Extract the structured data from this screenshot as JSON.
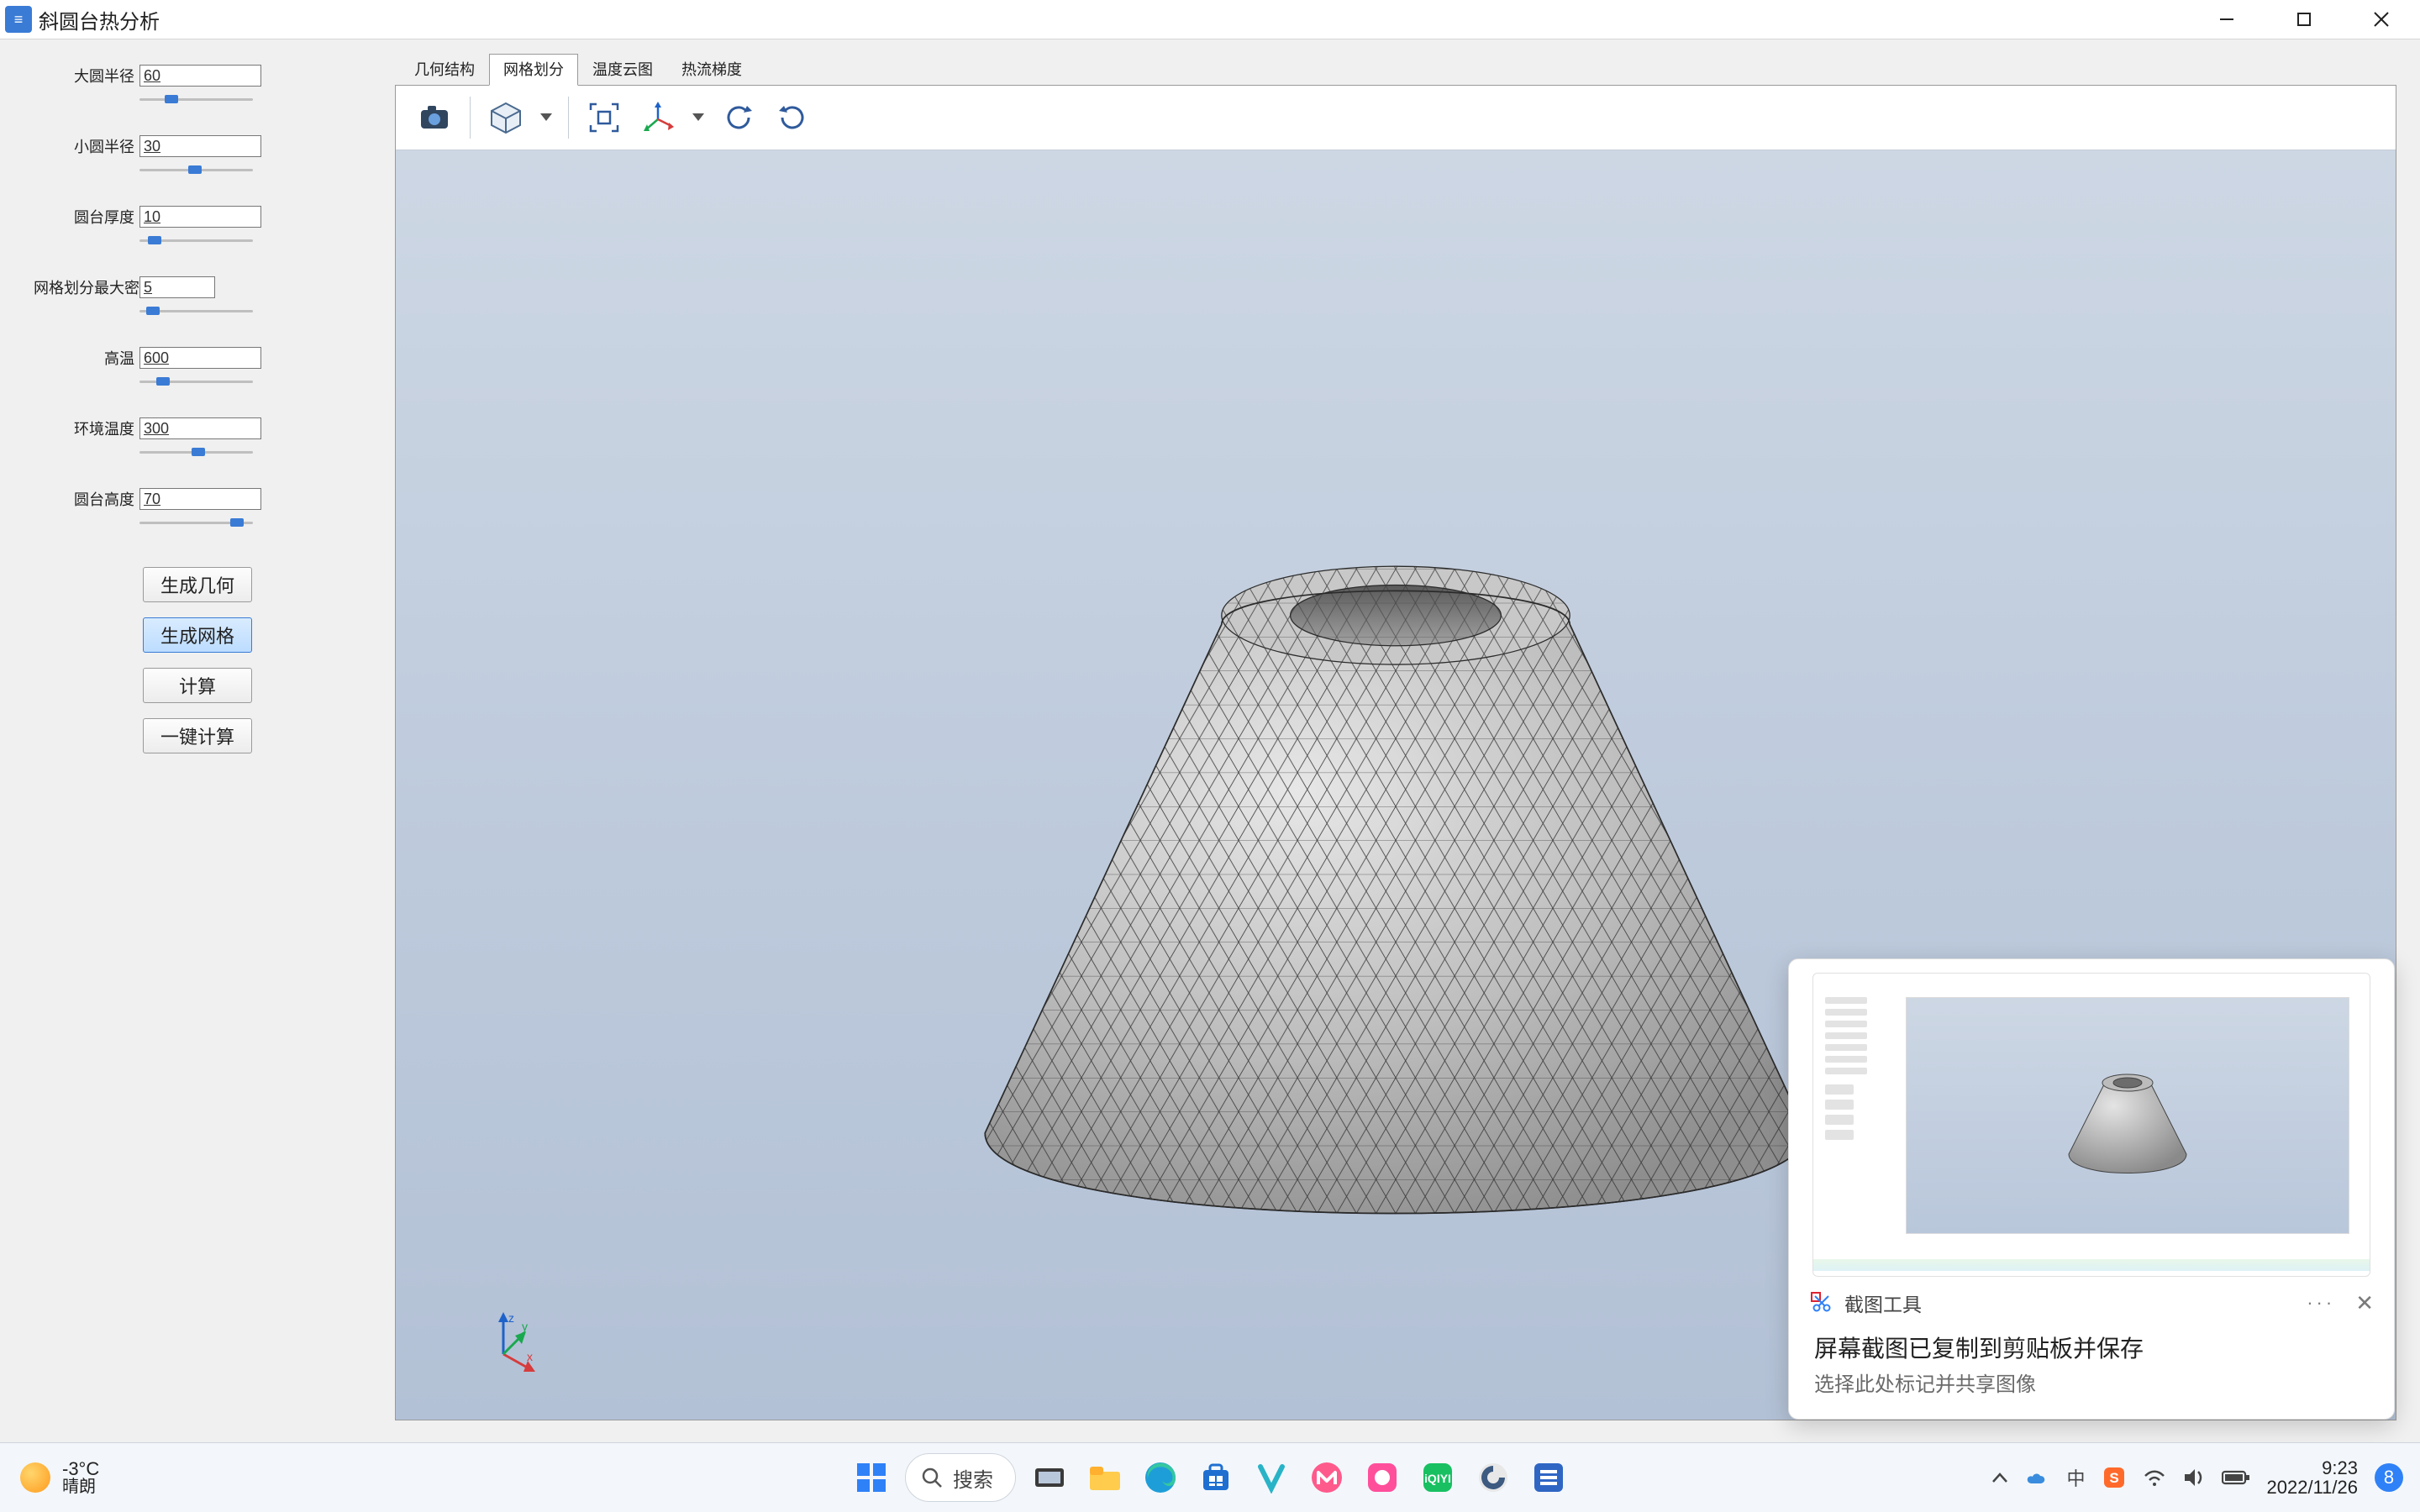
{
  "window": {
    "title": "斜圆台热分析"
  },
  "sidebar": {
    "params": [
      {
        "label": "大圆半径",
        "value": "60",
        "thumb": 30
      },
      {
        "label": "小圆半径",
        "value": "30",
        "thumb": 58
      },
      {
        "label": "圆台厚度",
        "value": "10",
        "thumb": 10
      },
      {
        "label": "网格划分最大密度",
        "value": "5",
        "thumb": 8
      },
      {
        "label": "高温",
        "value": "600",
        "thumb": 20
      },
      {
        "label": "环境温度",
        "value": "300",
        "thumb": 62
      },
      {
        "label": "圆台高度",
        "value": "70",
        "thumb": 108
      }
    ],
    "buttons": {
      "gen_geom": "生成几何",
      "gen_mesh": "生成网格",
      "compute": "计算",
      "one_click": "一键计算"
    }
  },
  "tabs": [
    "几何结构",
    "网格划分",
    "温度云图",
    "热流梯度"
  ],
  "active_tab_index": 1,
  "toast": {
    "app_name": "截图工具",
    "line1": "屏幕截图已复制到剪贴板并保存",
    "line2": "选择此处标记并共享图像"
  },
  "taskbar": {
    "weather_temp": "-3°C",
    "weather_cond": "晴朗",
    "search_placeholder": "搜索",
    "time": "9:23",
    "date": "2022/11/26",
    "notif_count": "8",
    "ime": "中"
  }
}
